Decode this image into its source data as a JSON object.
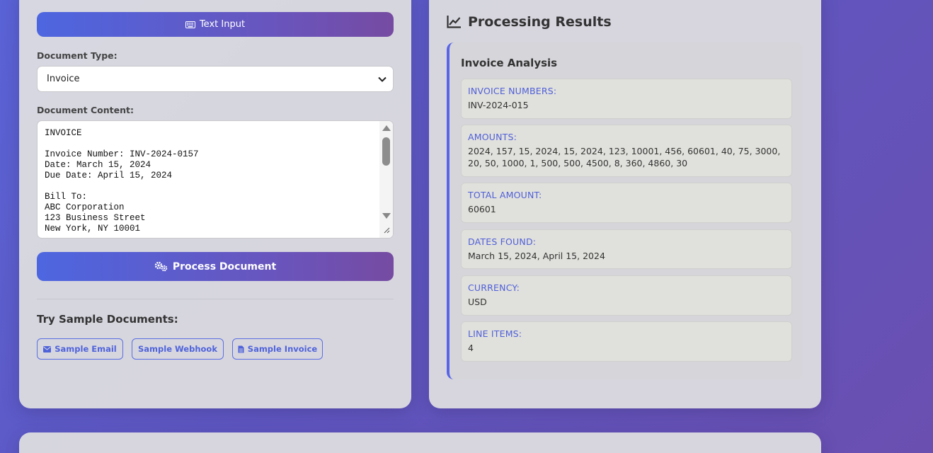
{
  "left_panel": {
    "tab_label": "Text Input",
    "doc_type_label": "Document Type:",
    "doc_type_value": "Invoice",
    "doc_content_label": "Document Content:",
    "doc_content_value": "INVOICE\n\nInvoice Number: INV-2024-0157\nDate: March 15, 2024\nDue Date: April 15, 2024\n\nBill To:\nABC Corporation\n123 Business Street\nNew York, NY 10001",
    "process_label": "Process Document",
    "samples_title": "Try Sample Documents:",
    "samples": [
      {
        "label": "Sample Email",
        "icon": "envelope-icon"
      },
      {
        "label": "Sample Webhook",
        "icon": ""
      },
      {
        "label": "Sample Invoice",
        "icon": "document-icon"
      }
    ]
  },
  "results": {
    "title": "Processing Results",
    "card_title": "Invoice Analysis",
    "fields": [
      {
        "label": "INVOICE NUMBERS:",
        "value": "INV-2024-015"
      },
      {
        "label": "AMOUNTS:",
        "value": "2024, 157, 15, 2024, 15, 2024, 123, 10001, 456, 60601, 40, 75, 3000, 20, 50, 1000, 1, 500, 500, 4500, 8, 360, 4860, 30"
      },
      {
        "label": "TOTAL AMOUNT:",
        "value": "60601"
      },
      {
        "label": "DATES FOUND:",
        "value": "March 15, 2024, April 15, 2024"
      },
      {
        "label": "CURRENCY:",
        "value": "USD"
      },
      {
        "label": "LINE ITEMS:",
        "value": "4"
      }
    ]
  },
  "colors": {
    "accent": "#5b6fe0",
    "gradient_start": "#4d66e0",
    "gradient_end": "#764ba2"
  }
}
